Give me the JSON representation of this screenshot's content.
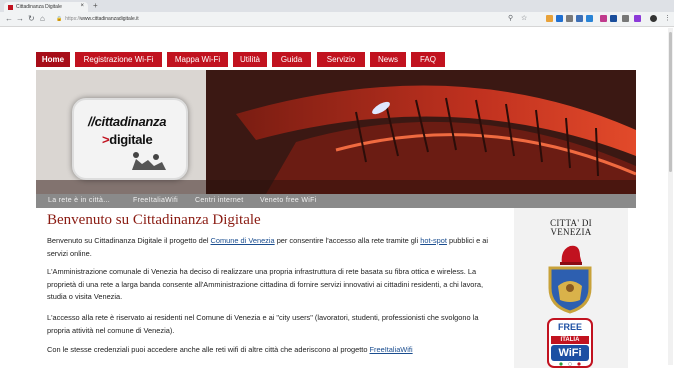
{
  "browser": {
    "tab_title": "Cittadinanza Digitale",
    "tab_close": "×",
    "new_tab": "+",
    "url_protocol": "https://",
    "url_domain": "www.cittadinanzadigitale.it",
    "nav": {
      "back": "←",
      "forward": "→",
      "reload": "↻",
      "home": "⌂"
    },
    "icons": {
      "search": "⚲",
      "star": "☆",
      "menu": "⋮"
    }
  },
  "site": {
    "menu": [
      {
        "label": "Home",
        "active": true
      },
      {
        "label": "Registrazione Wi-Fi",
        "active": false
      },
      {
        "label": "Mappa Wi-Fi",
        "active": false
      },
      {
        "label": "Utilità",
        "active": false
      },
      {
        "label": "Guida",
        "active": false
      },
      {
        "label": "Servizio",
        "active": false
      },
      {
        "label": "News",
        "active": false
      },
      {
        "label": "FAQ",
        "active": false
      }
    ],
    "logo": {
      "line1": "//cittadinanza",
      "line2_arrow": ">",
      "line2": "digitale"
    },
    "subnav": [
      "La rete è in città...",
      "FreeItaliaWifi",
      "Centri internet",
      "Veneto free WiFi"
    ],
    "title": "Benvenuto su Cittadinanza Digitale",
    "p1": {
      "t1": "Benvenuto su Cittadinanza Digitale il progetto del ",
      "link1": "Comune di Venezia",
      "t2": " per consentire l'accesso alla rete tramite gli ",
      "link2": "hot-spot",
      "t3": " pubblici e ai servizi online."
    },
    "p2": "L'Amministrazione comunale di Venezia ha deciso di realizzare una propria infrastruttura di rete basata su fibra ottica e wireless. La proprietà di una rete a larga banda consente all'Amministrazione cittadina di fornire servizi innovativi ai cittadini residenti, a chi lavora, studia o visita Venezia.",
    "p3": "L'accesso alla rete è riservato ai residenti nel Comune di Venezia e ai \"city users\" (lavoratori, studenti, professionisti che svolgono la propria attività nel comune di Venezia).",
    "p4": {
      "t1": "Con le stesse credenziali puoi accedere anche alle reti wifi di altre città che aderiscono al progetto ",
      "link": "FreeItaliaWifi"
    },
    "sidebar": {
      "seal_line1": "CITTA' DI",
      "seal_line2": "VENEZIA",
      "wifi_top": "FREE",
      "wifi_mid": "ITALIA",
      "wifi_bottom": "WiFi"
    },
    "colors": {
      "nav_red": "#c1121f",
      "title_red": "#8a1b12",
      "link_blue": "#1a4d8f"
    }
  }
}
